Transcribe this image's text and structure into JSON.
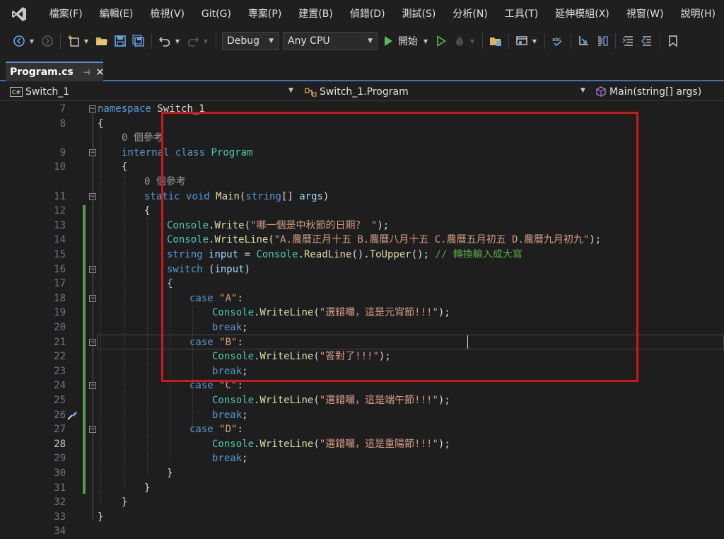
{
  "menu": {
    "items": [
      "檔案(F)",
      "編輯(E)",
      "檢視(V)",
      "Git(G)",
      "專案(P)",
      "建置(B)",
      "偵錯(D)",
      "測試(S)",
      "分析(N)",
      "工具(T)",
      "延伸模組(X)",
      "視窗(W)",
      "說明(H)"
    ]
  },
  "toolbar": {
    "configuration": "Debug",
    "platform": "Any CPU",
    "start_label": "開始"
  },
  "tabs": [
    {
      "label": "Program.cs",
      "pin_glyph": "⊣",
      "close_glyph": "✕"
    }
  ],
  "navigation": {
    "project": "Switch_1",
    "class": "Switch_1.Program",
    "member": "Main(string[] args)"
  },
  "editor": {
    "current_line": "28",
    "lines": [
      {
        "num": "7",
        "text": "namespace Switch_1"
      },
      {
        "num": "8",
        "text": "{"
      },
      {
        "num": "",
        "text": "0 個參考"
      },
      {
        "num": "9",
        "text": "internal class Program"
      },
      {
        "num": "10",
        "text": "{"
      },
      {
        "num": "",
        "text": "0 個參考"
      },
      {
        "num": "11",
        "text": "static void Main(string[] args)"
      },
      {
        "num": "12",
        "text": "{"
      },
      {
        "num": "13",
        "text": "Console.Write(\"哪一個是中秋節的日期？ \");"
      },
      {
        "num": "14",
        "text": "Console.WriteLine(\"A.農曆正月十五 B.農曆八月十五 C.農曆五月初五 D.農曆九月初九\");"
      },
      {
        "num": "15",
        "text": "string input = Console.ReadLine().ToUpper(); // 轉換輸入成大寫"
      },
      {
        "num": "16",
        "text": "switch (input)"
      },
      {
        "num": "17",
        "text": "{"
      },
      {
        "num": "18",
        "text": "case \"A\":"
      },
      {
        "num": "19",
        "text": "Console.WriteLine(\"選錯囉，這是元宵節!!!\");"
      },
      {
        "num": "20",
        "text": "break;"
      },
      {
        "num": "21",
        "text": "case \"B\":"
      },
      {
        "num": "22",
        "text": "Console.WriteLine(\"答對了!!!\");"
      },
      {
        "num": "23",
        "text": "break;"
      },
      {
        "num": "24",
        "text": "case \"C\":"
      },
      {
        "num": "25",
        "text": "Console.WriteLine(\"選錯囉，這是端午節!!!\");"
      },
      {
        "num": "26",
        "text": "break;"
      },
      {
        "num": "27",
        "text": "case \"D\":"
      },
      {
        "num": "28",
        "text": "Console.WriteLine(\"選錯囉，這是重陽節!!!\");"
      },
      {
        "num": "29",
        "text": "break;"
      },
      {
        "num": "30",
        "text": "}"
      },
      {
        "num": "31",
        "text": "}"
      },
      {
        "num": "32",
        "text": "}"
      },
      {
        "num": "33",
        "text": "}"
      },
      {
        "num": "34",
        "text": ""
      }
    ]
  },
  "colors": {
    "keyword": "#569cd6",
    "type": "#4ec9b0",
    "method": "#dcdcaa",
    "string": "#d69d85",
    "comment": "#57a64a",
    "highlight_border": "#d01818",
    "change_bar": "#4ea244"
  }
}
